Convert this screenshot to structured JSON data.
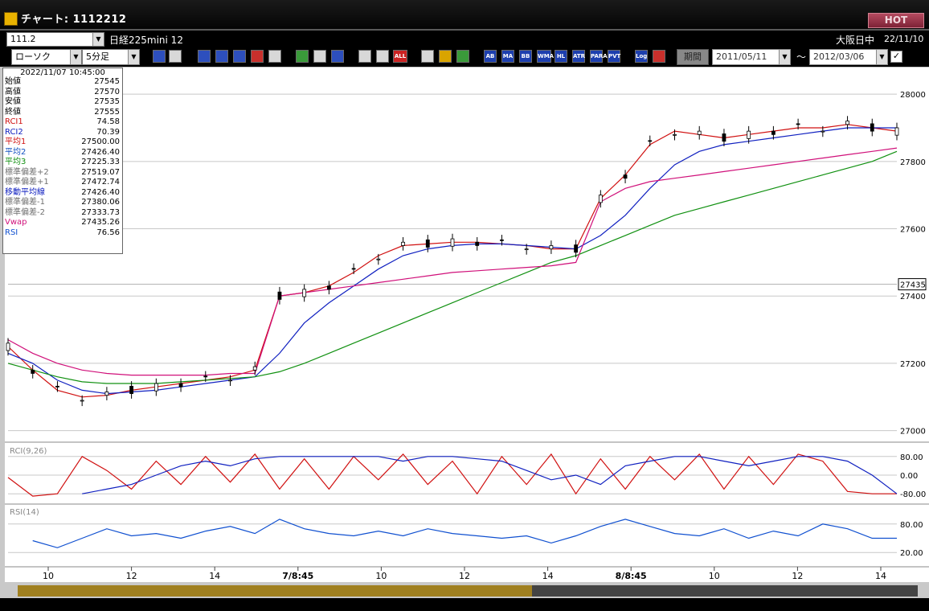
{
  "window": {
    "title": "チャート: 1112212",
    "hot_label": "HOT"
  },
  "symbol_bar": {
    "code": "111.2",
    "name": "日経225mini 12",
    "session": "大阪日中",
    "date": "22/11/10"
  },
  "toolbar": {
    "chart_type": "ローソク",
    "interval": "5分足",
    "period_label": "期間",
    "start_date": "2011/05/11",
    "tilde": "～",
    "end_date": "2012/03/06",
    "buttons": [
      "AB",
      "MA",
      "BB",
      "WMA",
      "HL",
      "ATR",
      "PARA",
      "PVT",
      "Log"
    ],
    "all_label": "ALL"
  },
  "info": {
    "datetime": "2022/11/07  10:45:00",
    "rows": [
      {
        "label": "始値",
        "value": "27545",
        "color": "#000000"
      },
      {
        "label": "高値",
        "value": "27570",
        "color": "#000000"
      },
      {
        "label": "安値",
        "value": "27535",
        "color": "#000000"
      },
      {
        "label": "終値",
        "value": "27555",
        "color": "#000000"
      },
      {
        "label": "RCI1",
        "value": "74.58",
        "color": "#d01010"
      },
      {
        "label": "RCI2",
        "value": "70.39",
        "color": "#1020c0"
      },
      {
        "label": "平均1",
        "value": "27500.00",
        "color": "#d01010"
      },
      {
        "label": "平均2",
        "value": "27426.40",
        "color": "#1050c0"
      },
      {
        "label": "平均3",
        "value": "27225.33",
        "color": "#109010"
      },
      {
        "label": "標準偏差+2",
        "value": "27519.07",
        "color": "#707070"
      },
      {
        "label": "標準偏差+1",
        "value": "27472.74",
        "color": "#707070"
      },
      {
        "label": "移動平均線",
        "value": "27426.40",
        "color": "#1020c0"
      },
      {
        "label": "標準偏差-1",
        "value": "27380.06",
        "color": "#707070"
      },
      {
        "label": "標準偏差-2",
        "value": "27333.73",
        "color": "#707070"
      },
      {
        "label": "Vwap",
        "value": "27435.26",
        "color": "#d0107a"
      },
      {
        "label": "RSI",
        "value": "76.56",
        "color": "#1050d0"
      }
    ]
  },
  "chart_data": [
    {
      "type": "line",
      "title": "",
      "y_ticks": [
        "28000",
        "27800",
        "27600",
        "27400",
        "27200",
        "27000"
      ],
      "ylim": [
        26980,
        28060
      ],
      "current_price_label": "27435",
      "x_tick_labels": [
        "10",
        "12",
        "14",
        "7/8:45",
        "10",
        "12",
        "14",
        "8/8:45",
        "10",
        "12",
        "14"
      ],
      "series": [
        {
          "name": "平均1",
          "color": "#d01010",
          "values": [
            27250,
            27180,
            27120,
            27100,
            27105,
            27120,
            27130,
            27140,
            27150,
            27160,
            27180,
            27400,
            27410,
            27430,
            27470,
            27520,
            27550,
            27555,
            27560,
            27560,
            27555,
            27550,
            27540,
            27540,
            27690,
            27760,
            27850,
            27890,
            27880,
            27870,
            27880,
            27890,
            27900,
            27900,
            27910,
            27900,
            27890
          ]
        },
        {
          "name": "平均2",
          "color": "#1020c0",
          "values": [
            27230,
            27200,
            27150,
            27120,
            27110,
            27115,
            27120,
            27130,
            27140,
            27150,
            27160,
            27230,
            27320,
            27380,
            27430,
            27480,
            27520,
            27540,
            27550,
            27555,
            27555,
            27550,
            27545,
            27540,
            27580,
            27640,
            27720,
            27790,
            27830,
            27850,
            27860,
            27870,
            27880,
            27890,
            27900,
            27900,
            27900
          ]
        },
        {
          "name": "平均3",
          "color": "#109010",
          "values": [
            27200,
            27180,
            27160,
            27145,
            27140,
            27140,
            27140,
            27145,
            27150,
            27155,
            27160,
            27175,
            27200,
            27230,
            27260,
            27290,
            27320,
            27350,
            27380,
            27410,
            27440,
            27470,
            27500,
            27520,
            27550,
            27580,
            27610,
            27640,
            27660,
            27680,
            27700,
            27720,
            27740,
            27760,
            27780,
            27800,
            27830
          ]
        },
        {
          "name": "Vwap",
          "color": "#d0107a",
          "values": [
            27270,
            27230,
            27200,
            27180,
            27170,
            27165,
            27165,
            27165,
            27165,
            27170,
            27170,
            27400,
            27410,
            27420,
            27430,
            27440,
            27450,
            27460,
            27470,
            27475,
            27480,
            27485,
            27490,
            27500,
            27680,
            27720,
            27740,
            27750,
            27760,
            27770,
            27780,
            27790,
            27800,
            27810,
            27820,
            27830,
            27840
          ]
        }
      ]
    },
    {
      "type": "line",
      "title": "RCI(9,26)",
      "y_ticks": [
        "80.00",
        "0.00",
        "-80.00"
      ],
      "ylim": [
        -100,
        100
      ],
      "series": [
        {
          "name": "RCI1",
          "color": "#d01010",
          "values": [
            -10,
            -90,
            -80,
            80,
            20,
            -60,
            60,
            -40,
            80,
            -30,
            90,
            -60,
            70,
            -60,
            80,
            -20,
            90,
            -40,
            60,
            -80,
            80,
            -40,
            90,
            -80,
            70,
            -60,
            80,
            -20,
            90,
            -60,
            80,
            -40,
            90,
            60,
            -70,
            -80,
            -80
          ]
        },
        {
          "name": "RCI2",
          "color": "#1020c0",
          "values": [
            null,
            null,
            null,
            -80,
            -60,
            -40,
            0,
            40,
            60,
            40,
            70,
            80,
            80,
            80,
            80,
            80,
            60,
            80,
            80,
            70,
            60,
            20,
            -20,
            0,
            -40,
            40,
            60,
            80,
            80,
            60,
            40,
            60,
            80,
            80,
            60,
            0,
            -80
          ]
        }
      ]
    },
    {
      "type": "line",
      "title": "RSI(14)",
      "y_ticks": [
        "80.00",
        "20.00"
      ],
      "ylim": [
        0,
        100
      ],
      "series": [
        {
          "name": "RSI",
          "color": "#1050d0",
          "values": [
            null,
            45,
            30,
            50,
            70,
            55,
            60,
            50,
            65,
            75,
            60,
            90,
            70,
            60,
            55,
            65,
            55,
            70,
            60,
            55,
            50,
            55,
            40,
            55,
            75,
            90,
            75,
            60,
            55,
            70,
            50,
            65,
            55,
            80,
            70,
            50,
            50
          ]
        }
      ]
    }
  ]
}
